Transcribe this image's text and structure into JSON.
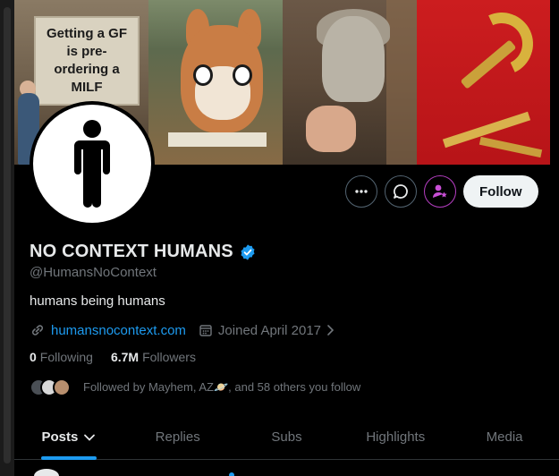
{
  "banner": {
    "sign_text": "Getting a GF is pre-ordering a MILF"
  },
  "profile": {
    "name": "NO CONTEXT HUMANS",
    "handle": "@HumansNoContext",
    "bio": "humans being humans",
    "link": "humansnocontext.com",
    "joined": "Joined April 2017",
    "following_count": "0",
    "following_label": "Following",
    "followers_count": "6.7M",
    "followers_label": "Followers",
    "followed_by": "Followed by Mayhem, AZ🪐, and 58 others you follow"
  },
  "actions": {
    "more_icon": "more-dots-icon",
    "message_icon": "message-bubble-icon",
    "subscribe_icon": "person-star-icon",
    "follow_label": "Follow"
  },
  "tabs": [
    {
      "label": "Posts"
    },
    {
      "label": "Replies"
    },
    {
      "label": "Subs"
    },
    {
      "label": "Highlights"
    },
    {
      "label": "Media"
    }
  ],
  "colors": {
    "accent": "#1d9bf0",
    "background": "#000000",
    "subscribe_border": "#b33dbf"
  }
}
